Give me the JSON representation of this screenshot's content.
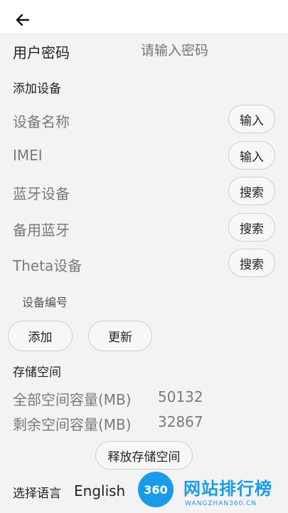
{
  "header": {
    "back_icon": "arrow-left-icon"
  },
  "password": {
    "label": "用户密码",
    "placeholder": "请输入密码"
  },
  "add_device": {
    "section_title": "添加设备",
    "rows": [
      {
        "label": "设备名称",
        "button": "输入"
      },
      {
        "label": "IMEI",
        "button": "输入"
      },
      {
        "label": "蓝牙设备",
        "button": "搜索"
      },
      {
        "label": "备用蓝牙",
        "button": "搜索"
      },
      {
        "label": "Theta设备",
        "button": "搜索"
      }
    ],
    "device_number_label": "设备编号",
    "add_button": "添加",
    "update_button": "更新"
  },
  "storage": {
    "section_title": "存储空间",
    "total_label": "全部空间容量(MB)",
    "total_value": "50132",
    "remaining_label": "剩余空间容量(MB)",
    "remaining_value": "32867",
    "release_button": "释放存储空间"
  },
  "language": {
    "label": "选择语言",
    "value": "English"
  },
  "watermark": {
    "badge": "360",
    "title": "网站排行榜",
    "subtitle": "WANGZHAN360.CN",
    "color": "#1a9be8"
  }
}
